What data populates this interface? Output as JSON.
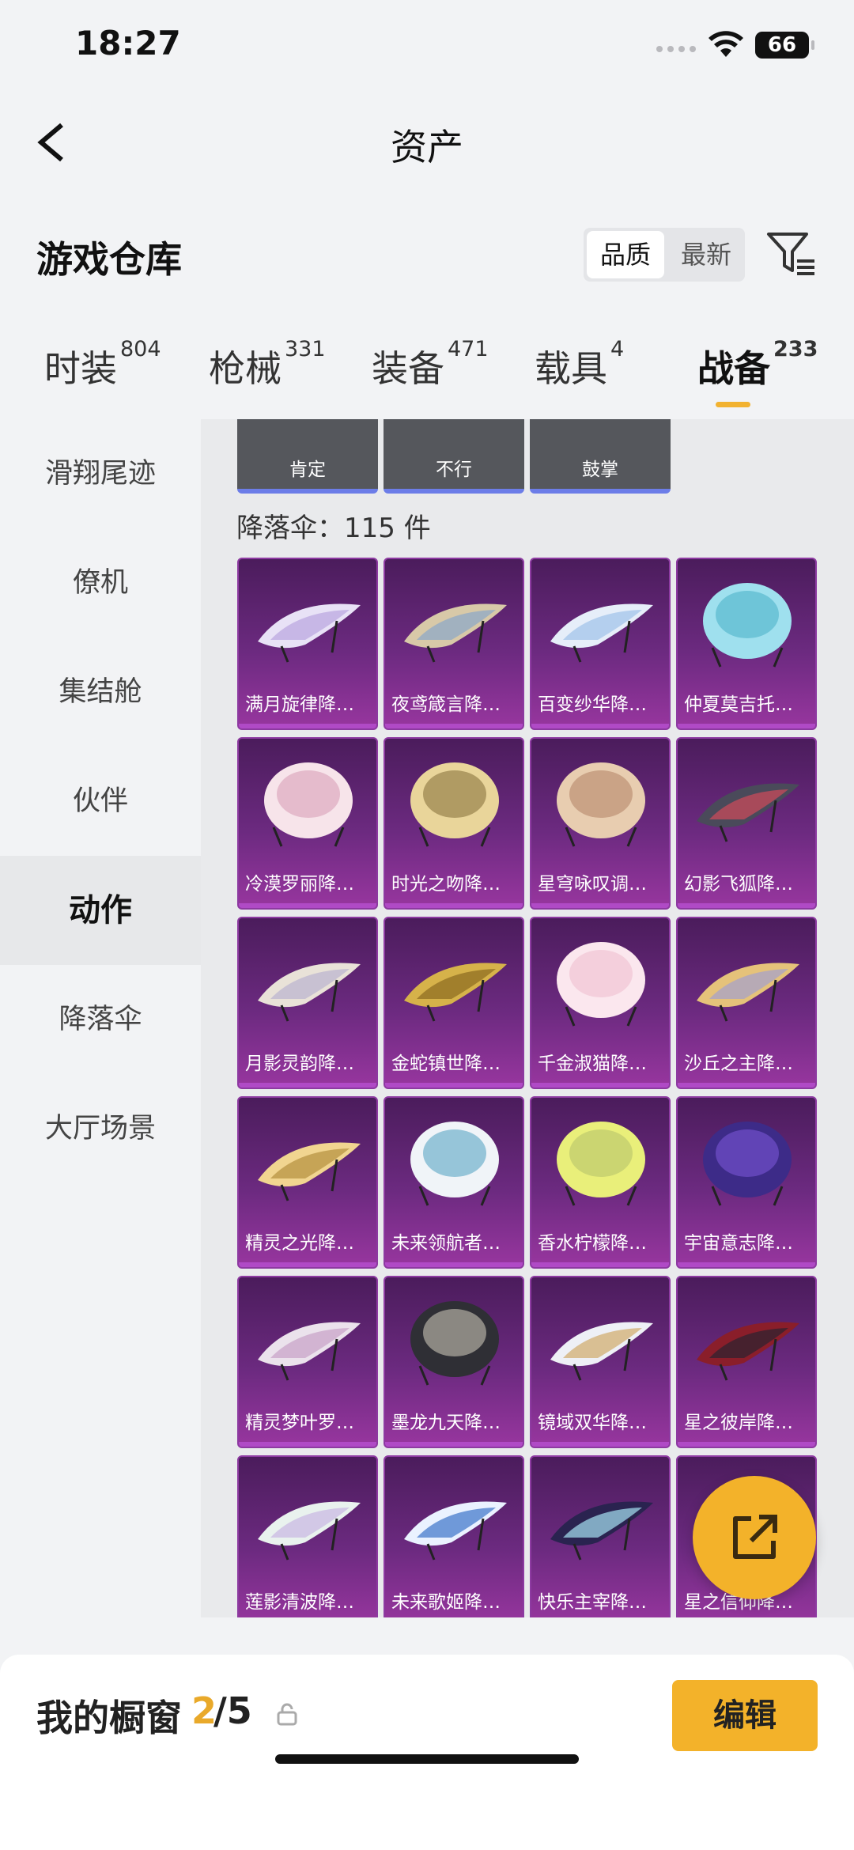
{
  "status": {
    "time": "18:27",
    "battery": "66"
  },
  "nav": {
    "title": "资产"
  },
  "header": {
    "title": "游戏仓库",
    "sort_quality": "品质",
    "sort_latest": "最新"
  },
  "tabs": [
    {
      "label": "时装",
      "count": "804"
    },
    {
      "label": "枪械",
      "count": "331"
    },
    {
      "label": "装备",
      "count": "471"
    },
    {
      "label": "载具",
      "count": "4"
    },
    {
      "label": "战备",
      "count": "233"
    }
  ],
  "sidebar": {
    "items": [
      "滑翔尾迹",
      "僚机",
      "集结舱",
      "伙伴",
      "动作",
      "降落伞",
      "大厅场景"
    ],
    "active": "动作"
  },
  "emotes": [
    "肯定",
    "不行",
    "鼓掌"
  ],
  "group": {
    "label": "降落伞：115 件"
  },
  "items": [
    "满月旋律降落伞",
    "夜鸢箴言降落伞",
    "百变纱华降落伞",
    "仲夏莫吉托降落伞",
    "冷漠罗丽降落伞",
    "时光之吻降落伞",
    "星穹咏叹调降落伞",
    "幻影飞狐降落伞",
    "月影灵韵降落伞",
    "金蛇镇世降落伞",
    "千金淑猫降落伞",
    "沙丘之主降落伞",
    "精灵之光降落伞",
    "未来领航者降落伞",
    "香水柠檬降落伞",
    "宇宙意志降落伞",
    "精灵梦叶罗降落伞",
    "墨龙九天降落伞",
    "镜域双华降落伞",
    "星之彼岸降落伞",
    "莲影清波降落伞",
    "未来歌姬降落伞",
    "快乐主宰降落伞",
    "星之信仰降落伞"
  ],
  "bottom": {
    "title": "我的橱窗",
    "count": "2",
    "total": "/5",
    "edit_label": "编辑"
  },
  "colors": {
    "accent": "#f3b22a",
    "card_bg": "#6c2a80"
  }
}
